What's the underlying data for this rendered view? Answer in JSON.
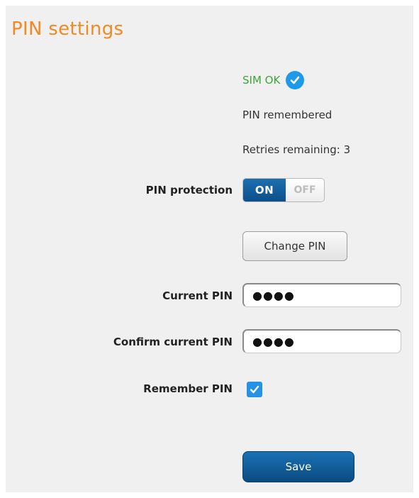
{
  "page": {
    "title": "PIN settings"
  },
  "status": {
    "sim_status": "SIM OK",
    "pin_status": "PIN remembered",
    "retries": "Retries remaining: 3"
  },
  "pin_protection": {
    "label": "PIN protection",
    "on_label": "ON",
    "off_label": "OFF",
    "state": "ON"
  },
  "change_pin": {
    "label": "Change PIN"
  },
  "current_pin": {
    "label": "Current PIN",
    "value_masked": "●●●●"
  },
  "confirm_pin": {
    "label": "Confirm current PIN",
    "value_masked": "●●●●"
  },
  "remember_pin": {
    "label": "Remember PIN",
    "checked": true
  },
  "save": {
    "label": "Save"
  },
  "colors": {
    "title": "#f08a24",
    "sim_ok": "#3aa63a",
    "accent_blue": "#1f9ae8",
    "toggle_on": "#0d4f89",
    "save_button": "#0b4a80",
    "panel_bg": "#f0f0f0"
  },
  "icons": {
    "sim_ok": "check-circle-icon",
    "remember": "checkbox-check-icon"
  }
}
